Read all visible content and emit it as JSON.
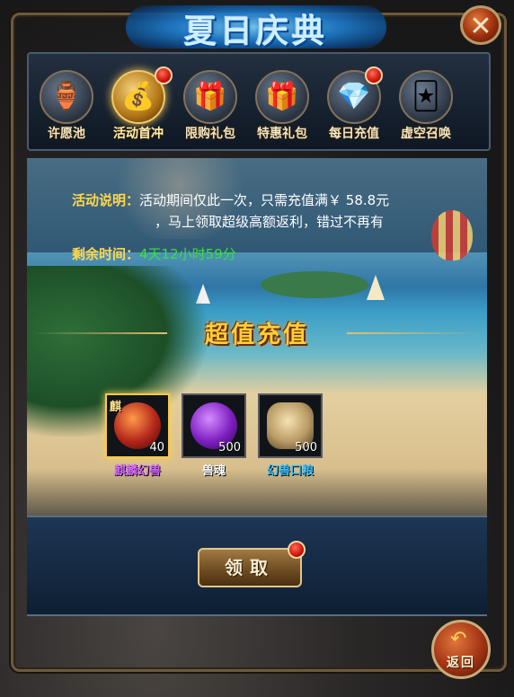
{
  "header": {
    "title": "夏日庆典",
    "close_symbol": "✕"
  },
  "tabs": [
    {
      "label": "许愿池",
      "icon": "wish-pool-icon",
      "glyph": "🏺",
      "badge": false
    },
    {
      "label": "活动首冲",
      "icon": "treasure-chest-icon",
      "glyph": "💰",
      "badge": true,
      "active": true
    },
    {
      "label": "限购礼包",
      "icon": "gift-box-icon",
      "glyph": "🎁",
      "badge": false
    },
    {
      "label": "特惠礼包",
      "icon": "gift-box-blue-icon",
      "glyph": "🎁",
      "badge": false
    },
    {
      "label": "每日充值",
      "icon": "gem-bowl-icon",
      "glyph": "💎",
      "badge": true
    },
    {
      "label": "虚空召唤",
      "icon": "summon-cards-icon",
      "glyph": "🃏",
      "badge": false
    }
  ],
  "activity": {
    "desc_label": "活动说明：",
    "desc_line1": "活动期间仅此一次，只需充值满￥ 58.8元",
    "desc_line2": "，马上领取超级高额返利，错过不再有",
    "time_label": "剩余时间：",
    "time_value": "4天12小时59分"
  },
  "banner": {
    "text": "超值充值"
  },
  "rewards": [
    {
      "name": "麒麟幻兽",
      "qty": "40",
      "badge_text": "麒",
      "name_color": "#d66cff",
      "rarity": "legendary"
    },
    {
      "name": "兽魂",
      "qty": "500",
      "name_color": "#ffffff",
      "rarity": "normal"
    },
    {
      "name": "幻兽口粮",
      "qty": "500",
      "name_color": "#3fc4ff",
      "rarity": "normal"
    }
  ],
  "actions": {
    "claim_label": "领取",
    "back_label": "返回",
    "back_symbol": "↶"
  },
  "colors": {
    "accent_gold": "#ffd84a",
    "timer_green": "#35e33a",
    "legend_purple": "#d66cff",
    "badge_red": "#cf1408"
  }
}
